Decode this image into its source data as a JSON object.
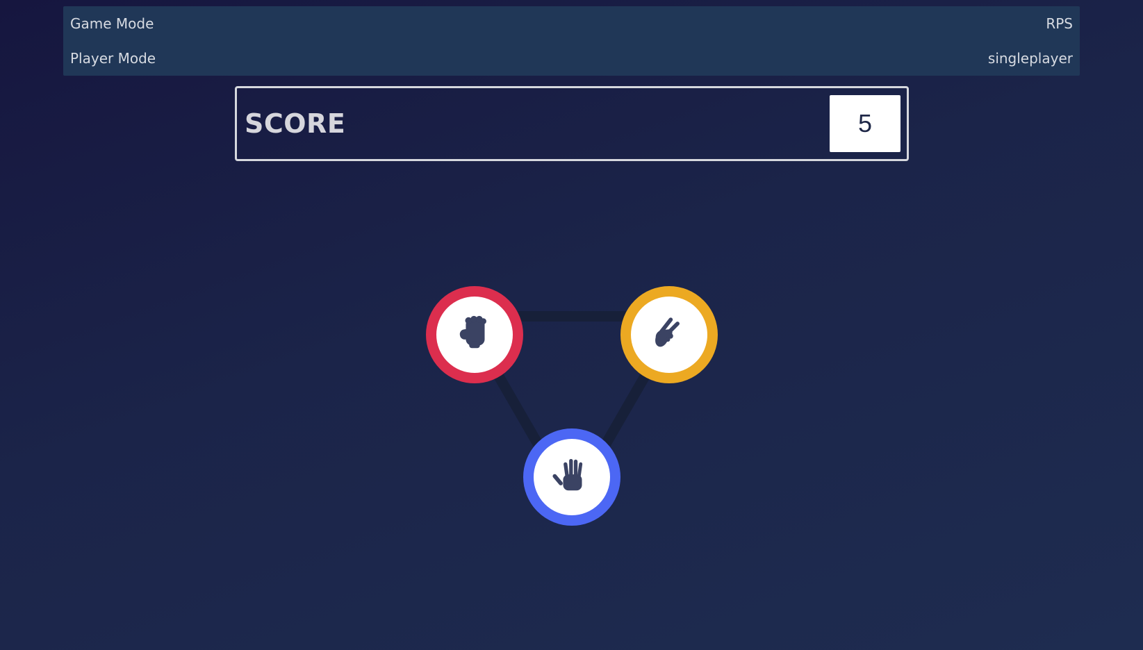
{
  "settings": {
    "game_mode_label": "Game Mode",
    "game_mode_value": "RPS",
    "player_mode_label": "Player Mode",
    "player_mode_value": "singleplayer"
  },
  "score": {
    "label": "SCORE",
    "value": "5"
  },
  "choices": [
    {
      "name": "rock",
      "icon": "fist-icon",
      "color": "#dc2e4e"
    },
    {
      "name": "scissors",
      "icon": "scissors-hand-icon",
      "color": "#eca922"
    },
    {
      "name": "paper",
      "icon": "open-hand-icon",
      "color": "#4c67f4"
    }
  ],
  "colors": {
    "panel": "#203757",
    "icon": "#3b4363",
    "background": "#1b2449"
  }
}
